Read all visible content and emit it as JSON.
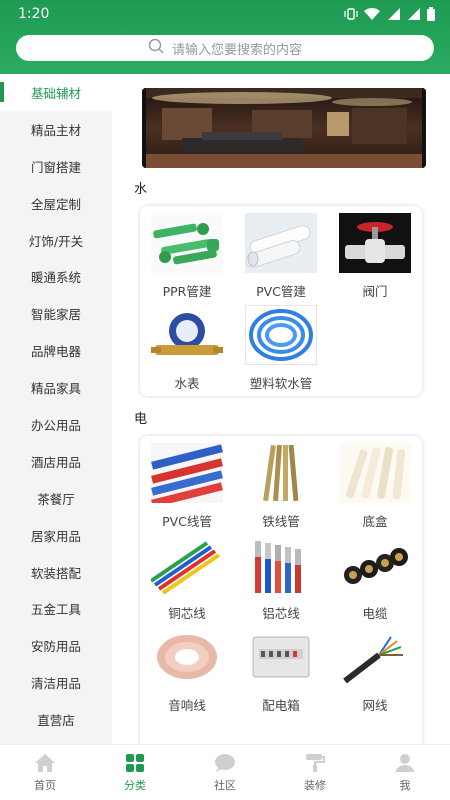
{
  "status": {
    "time": "1:20"
  },
  "search": {
    "placeholder": "请输入您要搜索的内容"
  },
  "sidebar": {
    "items": [
      {
        "label": "基础辅材",
        "active": true
      },
      {
        "label": "精品主材"
      },
      {
        "label": "门窗搭建"
      },
      {
        "label": "全屋定制"
      },
      {
        "label": "灯饰/开关"
      },
      {
        "label": "暖通系统"
      },
      {
        "label": "智能家居"
      },
      {
        "label": "品牌电器"
      },
      {
        "label": "精品家具"
      },
      {
        "label": "办公用品"
      },
      {
        "label": "酒店用品"
      },
      {
        "label": "茶餐厅"
      },
      {
        "label": "居家用品"
      },
      {
        "label": "软装搭配"
      },
      {
        "label": "五金工具"
      },
      {
        "label": "安防用品"
      },
      {
        "label": "清洁用品"
      },
      {
        "label": "直营店"
      }
    ]
  },
  "main": {
    "sections": [
      {
        "title": "水",
        "items": [
          {
            "label": "PPR管建",
            "icon": "green-ppr-pipe"
          },
          {
            "label": "PVC管建",
            "icon": "white-pvc-pipe"
          },
          {
            "label": "阀门",
            "icon": "red-valve"
          },
          {
            "label": "水表",
            "icon": "water-meter"
          },
          {
            "label": "塑料软水管",
            "icon": "blue-hose"
          }
        ]
      },
      {
        "title": "电",
        "items": [
          {
            "label": "PVC线管",
            "icon": "colored-conduit"
          },
          {
            "label": "铁线管",
            "icon": "iron-conduit"
          },
          {
            "label": "底盒",
            "icon": "bottom-box"
          },
          {
            "label": "铜芯线",
            "icon": "copper-wire"
          },
          {
            "label": "铝芯线",
            "icon": "aluminum-wire"
          },
          {
            "label": "电缆",
            "icon": "cable"
          },
          {
            "label": "音响线",
            "icon": "speaker-wire"
          },
          {
            "label": "配电箱",
            "icon": "distribution-box"
          },
          {
            "label": "网线",
            "icon": "network-cable"
          }
        ]
      }
    ]
  },
  "bottom_nav": [
    {
      "label": "首页",
      "icon": "home-icon"
    },
    {
      "label": "分类",
      "icon": "category-icon",
      "active": true
    },
    {
      "label": "社区",
      "icon": "community-icon"
    },
    {
      "label": "装修",
      "icon": "paint-roller-icon"
    },
    {
      "label": "我",
      "icon": "profile-icon"
    }
  ],
  "colors": {
    "brand": "#1e9b50",
    "header": "#25a55b"
  }
}
